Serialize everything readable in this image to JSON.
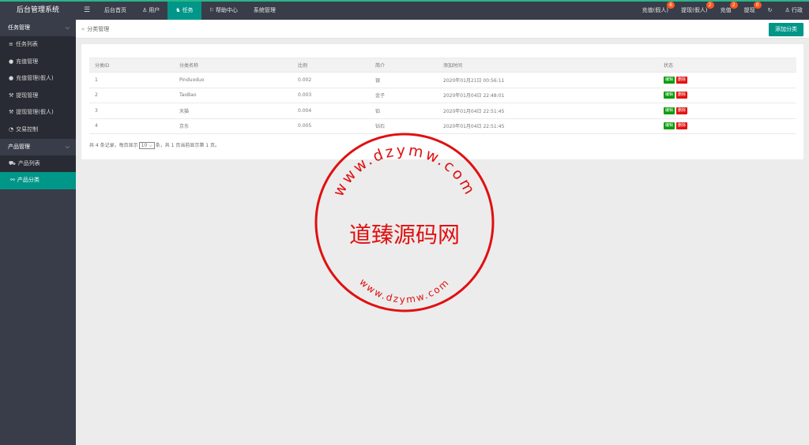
{
  "app": {
    "title": "后台管理系统"
  },
  "topnav": {
    "toggle_icon": "menu-icon",
    "items": [
      {
        "label": "后台首页",
        "icon": ""
      },
      {
        "label": "用户",
        "icon": "user-icon"
      },
      {
        "label": "任务",
        "icon": "task-icon"
      },
      {
        "label": "帮助中心",
        "icon": "flag-icon"
      },
      {
        "label": "系统管理",
        "icon": ""
      }
    ]
  },
  "rightnav": {
    "items": [
      {
        "label": "充值(假人)",
        "badge": "6"
      },
      {
        "label": "提现(假人)",
        "badge": "2"
      },
      {
        "label": "充值",
        "badge": "2"
      },
      {
        "label": "提现",
        "badge": "0"
      }
    ],
    "refresh_icon": "refresh-icon",
    "user": "行政"
  },
  "sidebar": {
    "groups": [
      {
        "label": "任务管理",
        "items": [
          {
            "label": "任务列表",
            "icon": "list-icon"
          },
          {
            "label": "充值管理",
            "icon": "comment-icon"
          },
          {
            "label": "充值管理(假人)",
            "icon": "comment-icon"
          },
          {
            "label": "提现管理",
            "icon": "hammer-icon"
          },
          {
            "label": "提现管理(假人)",
            "icon": "hammer-icon"
          },
          {
            "label": "交易控制",
            "icon": "dashboard-icon"
          }
        ]
      },
      {
        "label": "产品管理",
        "items": [
          {
            "label": "产品列表",
            "icon": "cart-icon"
          },
          {
            "label": "产品分类",
            "icon": "link-icon"
          }
        ]
      }
    ]
  },
  "breadcrumb": {
    "sep": "»",
    "current": "分类管理"
  },
  "toolbar": {
    "add_label": "添加分类"
  },
  "table": {
    "columns": [
      "分类ID",
      "分类名称",
      "比例",
      "简介",
      "添加时间",
      "状态"
    ],
    "rows": [
      {
        "id": "1",
        "name": "Pinduoduo",
        "ratio": "0.002",
        "intro": "银",
        "time": "2020年01月21日 00:56:11"
      },
      {
        "id": "2",
        "name": "TaoBao",
        "ratio": "0.003",
        "intro": "金子",
        "time": "2020年01月04日 22:48:01"
      },
      {
        "id": "3",
        "name": "天猫",
        "ratio": "0.004",
        "intro": "铂",
        "time": "2020年01月04日 22:51:45"
      },
      {
        "id": "4",
        "name": "京东",
        "ratio": "0.005",
        "intro": "钻石",
        "time": "2020年01月04日 22:51:45"
      }
    ],
    "edit_label": "编辑",
    "delete_label": "删除"
  },
  "pager": {
    "prefix": "共 4 条记录，每页显示",
    "per_page": "10",
    "suffix": "条，共 1 页当前显示第 1 页。"
  },
  "watermark": {
    "top_text": "www.dzymw.com",
    "center_text": "道臻源码网",
    "bottom_text": "www.dzymw.com",
    "color": "#e01010"
  }
}
